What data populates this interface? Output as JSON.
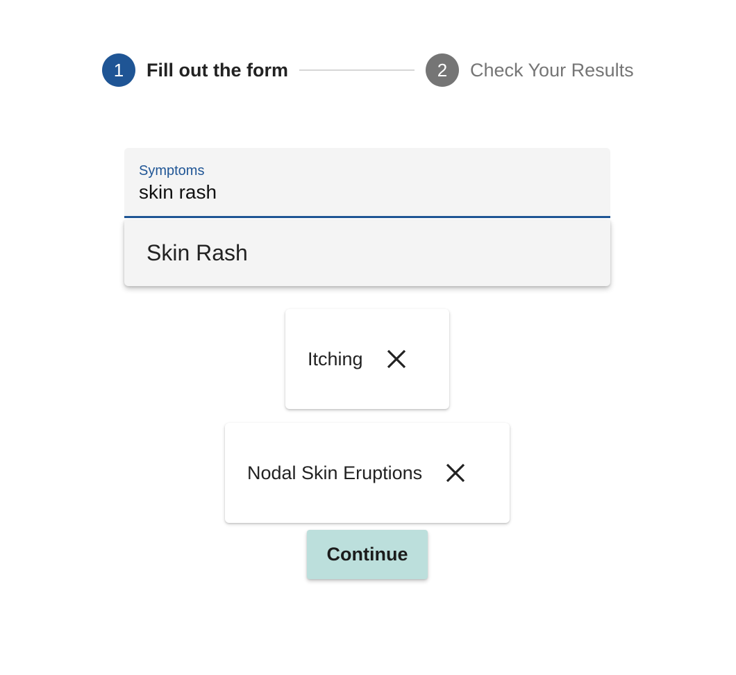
{
  "stepper": {
    "steps": [
      {
        "number": "1",
        "label": "Fill out the form",
        "state": "active"
      },
      {
        "number": "2",
        "label": "Check Your Results",
        "state": "inactive"
      }
    ]
  },
  "symptoms_field": {
    "label": "Symptoms",
    "value": "skin rash"
  },
  "autocomplete": {
    "options": [
      "Skin Rash"
    ]
  },
  "selected_symptoms": [
    {
      "label": "Itching",
      "remove_icon": "close-icon"
    },
    {
      "label": "Nodal Skin Eruptions",
      "remove_icon": "close-icon"
    }
  ],
  "actions": {
    "continue_label": "Continue"
  },
  "colors": {
    "primary": "#1f5595",
    "inactive_step": "#757575",
    "field_background": "#f4f4f4",
    "continue_button": "#bcdfdc"
  }
}
